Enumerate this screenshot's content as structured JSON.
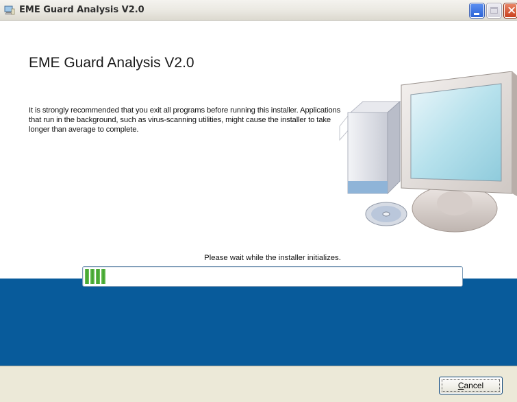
{
  "window": {
    "title": "EME Guard Analysis V2.0",
    "controls": [
      "minimize",
      "maximize",
      "close"
    ]
  },
  "content": {
    "heading": "EME Guard Analysis V2.0",
    "body": "It is strongly recommended that you exit all programs before running this installer. Applications that run in the background, such as virus-scanning utilities, might cause the installer to take longer than average to complete.",
    "illustration": "computer-illustration"
  },
  "progress": {
    "status": "Please wait while the installer initializes.",
    "value": 0.055
  },
  "footer": {
    "cancel_label": "Cancel",
    "cancel_mnemonic": "C"
  },
  "colors": {
    "band": "#085b9b",
    "progress_fill": "#3ea12b",
    "footer_bg": "#ece9d8"
  }
}
